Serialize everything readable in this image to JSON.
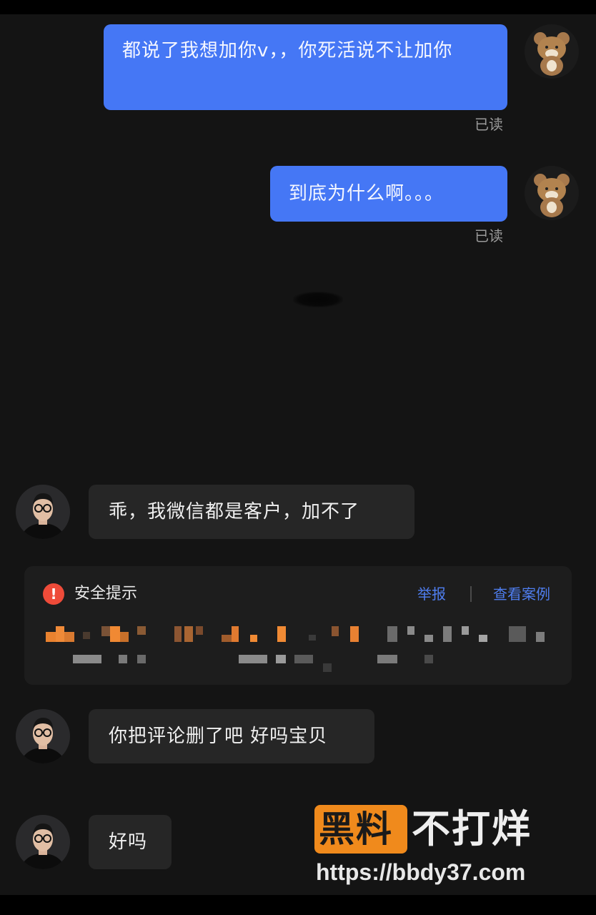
{
  "messages": [
    {
      "direction": "out",
      "text": "都说了我想加你v，，你死活说不让加你",
      "status": "已读"
    },
    {
      "direction": "out",
      "text": "到底为什么啊。。。",
      "status": "已读"
    },
    {
      "direction": "in",
      "text": "乖，我微信都是客户，加不了"
    },
    {
      "direction": "in",
      "text": "你把评论删了吧 好吗宝贝"
    },
    {
      "direction": "in",
      "text": "好吗"
    }
  ],
  "safety_notice": {
    "icon": "exclamation-icon",
    "icon_glyph": "!",
    "title": "安全提示",
    "report_label": "举报",
    "view_cases_label": "查看案例",
    "colors": {
      "alert": "#ee4b39",
      "link": "#4f7ef0"
    }
  },
  "watermark": {
    "brand_boxed": "黑料",
    "brand_rest": "不打烊",
    "url": "https://bbdy37.com",
    "colors": {
      "box": "#f08a1c"
    }
  },
  "colors": {
    "outgoing_bubble": "#4577f5",
    "incoming_bubble": "#262626",
    "background": "#141414"
  }
}
